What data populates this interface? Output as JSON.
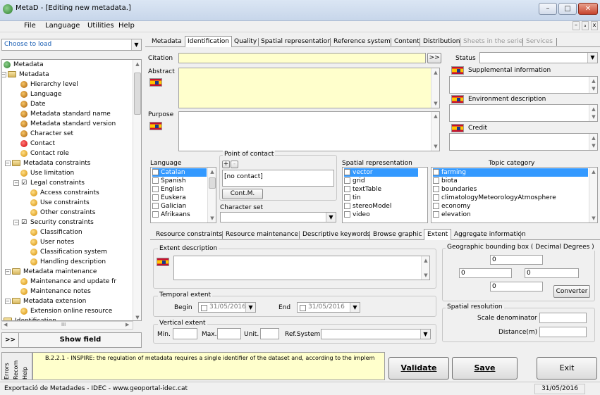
{
  "window": {
    "title": "MetaD - [Editing new metadata.]",
    "min": "–",
    "max": "□",
    "close": "✕",
    "mdi_min": "–",
    "mdi_restore": "ₐ",
    "mdi_close": "x"
  },
  "menu": [
    "File",
    "Language",
    "Utilities",
    "Help"
  ],
  "left": {
    "loader_value": "Choose to load",
    "tree": [
      {
        "label": "Metadata",
        "icon": "globe-icon"
      },
      {
        "label": "Metadata",
        "icon": "folder-icon"
      },
      {
        "label": "Hierarchy level",
        "icon": "bullet-icon"
      },
      {
        "label": "Language",
        "icon": "bullet-icon"
      },
      {
        "label": "Date",
        "icon": "bullet-icon"
      },
      {
        "label": "Metadata standard name",
        "icon": "bullet-icon"
      },
      {
        "label": "Metadata standard version",
        "icon": "bullet-icon"
      },
      {
        "label": "Character set",
        "icon": "bullet-icon"
      },
      {
        "label": "Contact",
        "icon": "required-icon"
      },
      {
        "label": "Contact role",
        "icon": "optional-icon"
      },
      {
        "label": "Metadata constraints",
        "icon": "folder-icon"
      },
      {
        "label": "Use limitation",
        "icon": "optional-icon"
      },
      {
        "label": "Legal constraints",
        "icon": "check-icon"
      },
      {
        "label": "Access constraints",
        "icon": "optional-icon"
      },
      {
        "label": "Use constraints",
        "icon": "optional-icon"
      },
      {
        "label": "Other constraints",
        "icon": "optional-icon"
      },
      {
        "label": "Security constraints",
        "icon": "check-icon"
      },
      {
        "label": "Classification",
        "icon": "optional-icon"
      },
      {
        "label": "User notes",
        "icon": "optional-icon"
      },
      {
        "label": "Classification system",
        "icon": "optional-icon"
      },
      {
        "label": "Handling description",
        "icon": "optional-icon"
      },
      {
        "label": "Metadata maintenance",
        "icon": "folder-icon"
      },
      {
        "label": "Maintenance and update fr",
        "icon": "optional-icon"
      },
      {
        "label": "Maintenance notes",
        "icon": "optional-icon"
      },
      {
        "label": "Metadata extension",
        "icon": "folder-icon"
      },
      {
        "label": "Extension online resource",
        "icon": "optional-icon"
      },
      {
        "label": "Identification",
        "icon": "folder-icon"
      }
    ],
    "hscroll_grip": "III",
    "expand_btn": ">>",
    "show_field": "Show field"
  },
  "tabs": [
    "Metadata",
    "Identification",
    "Quality",
    "Spatial representation",
    "Reference system",
    "Content",
    "Distribution",
    "Sheets in the serie",
    "Services"
  ],
  "identification": {
    "citation_label": "Citation",
    "citation_btn": ">>",
    "abstract_label": "Abstract",
    "purpose_label": "Purpose",
    "status_label": "Status",
    "supplemental_label": "Supplemental information",
    "environment_label": "Environment description",
    "credit_label": "Credit",
    "language_label": "Language",
    "languages": [
      "Catalan",
      "Spanish",
      "English",
      "Euskera",
      "Galician",
      "Afrikaans"
    ],
    "poc_label": "Point of contact",
    "poc_plus": "+",
    "poc_minus": "-",
    "poc_value": "[no contact]",
    "poc_btn": "Cont.M.",
    "charset_label": "Character set",
    "spatial_label": "Spatial representation",
    "spatial_items": [
      "vector",
      "grid",
      "textTable",
      "tin",
      "stereoModel",
      "video"
    ],
    "topic_label": "Topic category",
    "topic_items": [
      "farming",
      "biota",
      "boundaries",
      "climatologyMeteorologyAtmosphere",
      "economy",
      "elevation"
    ]
  },
  "subtabs": [
    "Resource constraints",
    "Resource maintenance",
    "Descriptive keywords",
    "Browse graphic",
    "Extent",
    "Aggregate information"
  ],
  "extent": {
    "desc_label": "Extent description",
    "temporal_label": "Temporal extent",
    "begin_label": "Begin",
    "begin_value": "31/05/2016",
    "end_label": "End",
    "end_value": "31/05/2016",
    "vertical_label": "Vertical extent",
    "min_label": "Min.",
    "max_label": "Max.",
    "unit_label": "Unit.",
    "refsys_label": "Ref.System",
    "bbox_label": "Geographic bounding box ( Decimal Degrees )",
    "north": "0",
    "west": "0",
    "east": "0",
    "south": "0",
    "converter_btn": "Converter",
    "res_label": "Spatial resolution",
    "scale_label": "Scale denominator",
    "distance_label": "Distance(m)"
  },
  "bottom": {
    "side_tabs": [
      "Errors",
      "Recom",
      "Help"
    ],
    "message": "B.2.2.1 - INSPIRE: the regulation of metadata requires a single identifier of the dataset and, according to the implem",
    "validate": "Validate",
    "save": "Save",
    "exit": "Exit"
  },
  "status": {
    "left": "Exportació de Metadades - IDEC - www.geoportal-idec.cat",
    "date": "31/05/2016"
  },
  "colors": {
    "selection": "#3399ff",
    "required_field": "#ffffcc",
    "title_bar": "#dbe6f4"
  }
}
